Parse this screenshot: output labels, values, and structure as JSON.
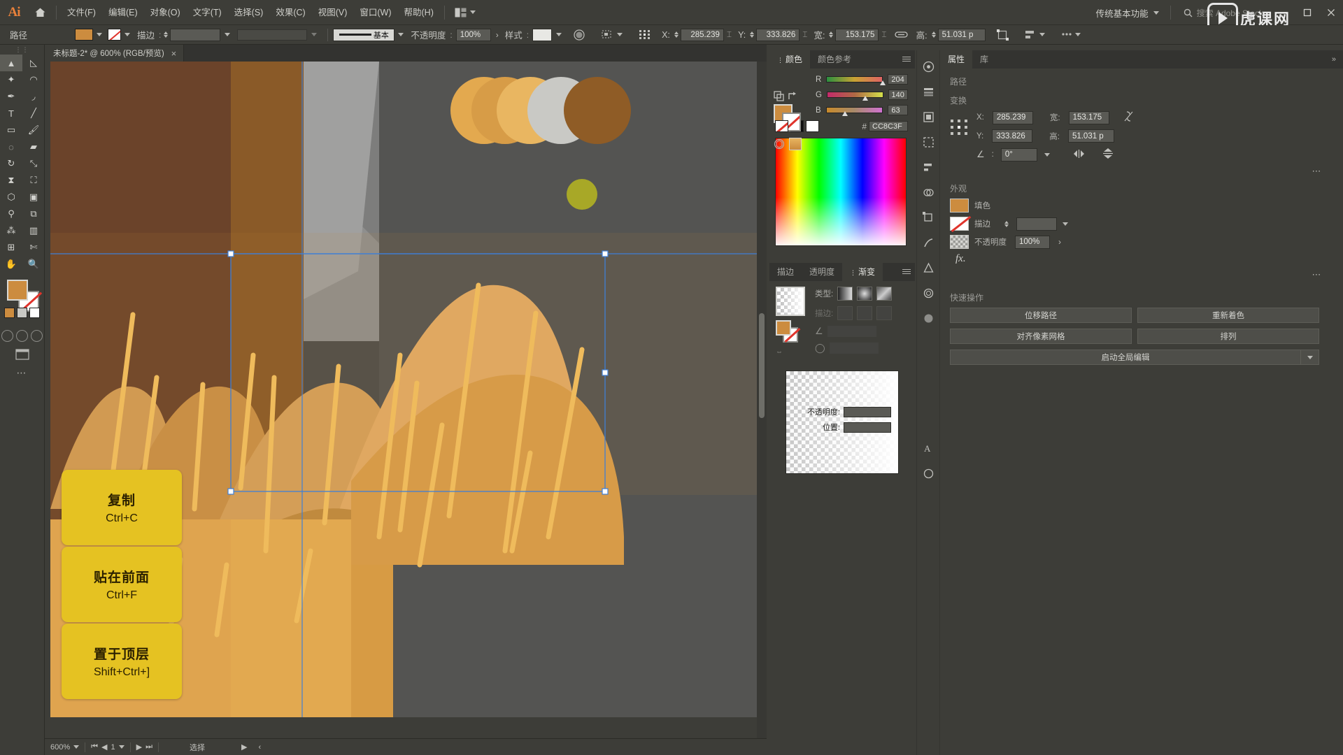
{
  "app": {
    "logo": "Ai",
    "home_icon": "home-icon"
  },
  "menubar": {
    "items": [
      "文件(F)",
      "编辑(E)",
      "对象(O)",
      "文字(T)",
      "选择(S)",
      "效果(C)",
      "视图(V)",
      "窗口(W)",
      "帮助(H)"
    ],
    "arrange_icon": "arrange-documents-icon",
    "workspace": "传统基本功能",
    "search_placeholder": "搜索 Adobe Stock",
    "search_icon": "search-icon",
    "win_minimize": "minimize-icon",
    "win_maximize": "maximize-icon",
    "win_close": "close-icon",
    "watermark": "虎课网"
  },
  "controlbar": {
    "path_label": "路径",
    "fill_color": "#CC8C3F",
    "stroke_none_icon": "no-color-icon",
    "stroke_label": "描边",
    "stroke_weight": "",
    "stroke_profile_label": "基本",
    "opacity_label": "不透明度",
    "opacity_value": "100%",
    "style_label": "样式",
    "recolor_icon": "recolor-artwork-icon",
    "select_similar_icon": "select-similar-icon",
    "anchor_icon": "reference-point-icon",
    "x_label": "X:",
    "x_value": "285.239",
    "y_label": "Y:",
    "y_value": "333.826",
    "w_label": "宽:",
    "w_value": "153.175",
    "link_icon": "link-ratio-icon",
    "h_label": "高:",
    "h_value": "51.031 p",
    "transform_icon": "transform-icon",
    "align_icon": "align-icon",
    "more_icon": "more-options-icon"
  },
  "toolbar": {
    "grip": "⋮⋮",
    "tools": [
      {
        "name": "selection-tool",
        "glyph": "▲",
        "selected": true
      },
      {
        "name": "direct-selection-tool",
        "glyph": "◺",
        "selected": false
      },
      {
        "name": "magic-wand-tool",
        "glyph": "✦",
        "selected": false
      },
      {
        "name": "lasso-tool",
        "glyph": "◠",
        "selected": false
      },
      {
        "name": "pen-tool",
        "glyph": "✒",
        "selected": false
      },
      {
        "name": "curvature-tool",
        "glyph": "◞",
        "selected": false
      },
      {
        "name": "type-tool",
        "glyph": "T",
        "selected": false
      },
      {
        "name": "line-segment-tool",
        "glyph": "╱",
        "selected": false
      },
      {
        "name": "rectangle-tool",
        "glyph": "▭",
        "selected": false
      },
      {
        "name": "paintbrush-tool",
        "glyph": "🖌",
        "selected": false
      },
      {
        "name": "shaper-tool",
        "glyph": "◌",
        "selected": false
      },
      {
        "name": "eraser-tool",
        "glyph": "▰",
        "selected": false
      },
      {
        "name": "rotate-tool",
        "glyph": "↻",
        "selected": false
      },
      {
        "name": "scale-tool",
        "glyph": "⤡",
        "selected": false
      },
      {
        "name": "width-tool",
        "glyph": "⧗",
        "selected": false
      },
      {
        "name": "free-transform-tool",
        "glyph": "⛶",
        "selected": false
      },
      {
        "name": "shape-builder-tool",
        "glyph": "⬡",
        "selected": false
      },
      {
        "name": "gradient-tool",
        "glyph": "▣",
        "selected": false
      },
      {
        "name": "eyedropper-tool",
        "glyph": "⚲",
        "selected": false
      },
      {
        "name": "blend-tool",
        "glyph": "⧉",
        "selected": false
      },
      {
        "name": "symbol-sprayer-tool",
        "glyph": "⁂",
        "selected": false
      },
      {
        "name": "column-graph-tool",
        "glyph": "▥",
        "selected": false
      },
      {
        "name": "artboard-tool",
        "glyph": "⊞",
        "selected": false
      },
      {
        "name": "slice-tool",
        "glyph": "✄",
        "selected": false
      },
      {
        "name": "hand-tool",
        "glyph": "✋",
        "selected": false
      },
      {
        "name": "zoom-tool",
        "glyph": "🔍",
        "selected": false
      }
    ],
    "fill_color": "#CC8C3F",
    "stroke_icon": "stroke-none-icon",
    "swatch_colors": [
      "#CC8C3F",
      "#8a8a86",
      "#e0342c"
    ],
    "mode_icons": [
      "color-mode-icon",
      "gradient-mode-icon",
      "none-mode-icon"
    ],
    "screen_mode_icon": "screen-mode-icon",
    "more_icon": "edit-toolbar-icon"
  },
  "document": {
    "tab_title": "未标题-2* @ 600% (RGB/预览)",
    "close_icon": "close-tab-icon"
  },
  "statusbar": {
    "zoom": "600%",
    "nav_first_icon": "first-page-icon",
    "nav_prev_icon": "prev-page-icon",
    "page": "1",
    "nav_next_icon": "next-page-icon",
    "nav_last_icon": "last-page-icon",
    "status_text": "选择",
    "play_icon": "play-icon",
    "back_icon": "back-icon"
  },
  "color_panel": {
    "tabs": [
      {
        "label": "颜色",
        "active": true
      },
      {
        "label": "颜色参考",
        "active": false
      }
    ],
    "menu_icon": "panel-menu-icon",
    "sliders": [
      {
        "label": "R",
        "value": "204",
        "pct": 80
      },
      {
        "label": "G",
        "value": "140",
        "pct": 55
      },
      {
        "label": "B",
        "value": "63",
        "pct": 25
      }
    ],
    "hex_prefix": "#",
    "hex": "CC8C3F",
    "fill_color": "#CC8C3F",
    "none_icon": "none-swatch-icon",
    "white_icon": "white-swatch-icon",
    "swap_icon": "swap-fill-stroke-icon",
    "cube_icon": "out-of-gamut-icon"
  },
  "gradient_panel": {
    "tabs": [
      {
        "label": "描边",
        "active": false
      },
      {
        "label": "透明度",
        "active": false
      },
      {
        "label": "渐变",
        "active": true
      }
    ],
    "menu_icon": "panel-menu-icon",
    "type_label": "类型:",
    "type_buttons": [
      "linear-gradient-icon",
      "radial-gradient-icon",
      "freeform-gradient-icon"
    ],
    "stroke_label": "描边:",
    "stroke_buttons": [
      "stroke-within-icon",
      "stroke-along-icon",
      "stroke-across-icon"
    ],
    "angle_icon": "gradient-angle-icon",
    "aspect_icon": "gradient-aspect-icon",
    "opacity_label": "不透明度:",
    "opacity_value": "",
    "location_label": "位置:",
    "location_value": "",
    "delete_icon": "delete-stop-icon"
  },
  "properties": {
    "tabs": [
      {
        "label": "属性",
        "active": true
      },
      {
        "label": "库",
        "active": false
      }
    ],
    "collapse_icon": "collapse-panel-icon",
    "path_section": "路径",
    "transform_section": "变换",
    "ref_point_icon": "reference-point-icon",
    "x_label": "X:",
    "x_value": "285.239",
    "y_label": "Y:",
    "y_value": "333.826",
    "w_label": "宽:",
    "w_value": "153.175",
    "h_label": "高:",
    "h_value": "51.031 p",
    "link_icon": "unlink-ratio-icon",
    "angle_icon": "rotate-angle-icon",
    "angle_value": "0°",
    "flip_h_icon": "flip-horizontal-icon",
    "flip_v_icon": "flip-vertical-icon",
    "more_icon": "more-options-icon",
    "appearance_section": "外观",
    "fill_label": "填色",
    "fill_color": "#CC8C3F",
    "stroke_label": "描边",
    "stroke_value": "",
    "opacity_label": "不透明度",
    "opacity_value": "100%",
    "fx_label": "fx.",
    "quick_actions_section": "快速操作",
    "quick_actions": [
      "位移路径",
      "重新着色",
      "对齐像素网格",
      "排列"
    ],
    "global_edit": "启动全局编辑"
  },
  "icon_rail": [
    "libraries-icon",
    "layers-icon",
    "artboards-icon",
    "asset-export-icon",
    "align-icon",
    "pathfinder-icon",
    "transform-icon",
    "brushes-icon",
    "symbols-icon",
    "graphic-styles-icon",
    "appearance-icon",
    "character-icon",
    "paragraph-icon"
  ],
  "cards": [
    {
      "title": "复制",
      "shortcut": "Ctrl+C"
    },
    {
      "title": "贴在前面",
      "shortcut": "Ctrl+F"
    },
    {
      "title": "置于顶层",
      "shortcut": "Shift+Ctrl+]"
    }
  ],
  "colors": {
    "ui_bg": "#3d3d38",
    "accent_fill": "#CC8C3F",
    "card_yellow": "#E5C222",
    "selection_blue": "#3f7fd6"
  }
}
